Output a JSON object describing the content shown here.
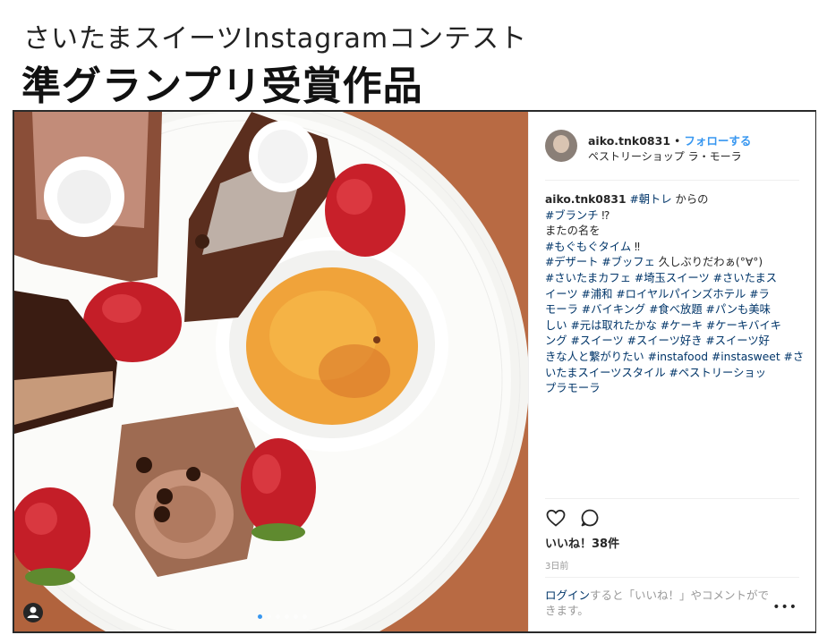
{
  "page": {
    "subtitle": "さいたまスイーツInstagramコンテスト",
    "title": "準グランプリ受賞作品"
  },
  "post": {
    "username": "aiko.tnk0831",
    "separator": "•",
    "follow_label": "フォローする",
    "location": "ペストリーショップ ラ・モーラ",
    "caption_user": "aiko.tnk0831",
    "caption_lines": [
      [
        {
          "t": "#朝トレ",
          "tag": true
        },
        {
          "t": " からの",
          "tag": false
        }
      ],
      [
        {
          "t": "#ブランチ",
          "tag": true
        },
        {
          "t": " ⁉",
          "tag": false
        }
      ],
      [
        {
          "t": "またの名を",
          "tag": false
        }
      ],
      [
        {
          "t": "#もぐもぐタイム",
          "tag": true
        },
        {
          "t": " ‼",
          "tag": false
        }
      ],
      [
        {
          "t": "#デザート #ブッフェ",
          "tag": true
        },
        {
          "t": " 久しぶりだわぁ(°∀°)",
          "tag": false
        }
      ],
      [
        {
          "t": "#さいたまカフェ #埼玉スイーツ #さいたまス",
          "tag": true
        }
      ],
      [
        {
          "t": "イーツ #浦和 #ロイヤルパインズホテル #ラ",
          "tag": true
        }
      ],
      [
        {
          "t": "モーラ #バイキング #食べ放題 #パンも美味",
          "tag": true
        }
      ],
      [
        {
          "t": "しい #元は取れたかな #ケーキ #ケーキバイキ",
          "tag": true
        }
      ],
      [
        {
          "t": "ング #スイーツ #スイーツ好き #スイーツ好",
          "tag": true
        }
      ],
      [
        {
          "t": "きな人と繋がりたい #instafood #instasweet #さ",
          "tag": true
        }
      ],
      [
        {
          "t": "いたまスイーツスタイル #ペストリーショッ",
          "tag": true
        }
      ],
      [
        {
          "t": "プラモーラ",
          "tag": true
        }
      ]
    ],
    "likes": "いいね！38件",
    "time": "3日前",
    "login_link": "ログイン",
    "login_rest": "すると「いいね！」やコメントができます。",
    "more": "•••",
    "carousel_count": 6,
    "carousel_active": 0
  },
  "icons": {
    "like": "heart-icon",
    "comment": "comment-icon",
    "tagged_user": "person-icon"
  },
  "colors": {
    "link_blue": "#3897f0",
    "hashtag": "#003569",
    "text": "#262626",
    "muted": "#999999"
  }
}
